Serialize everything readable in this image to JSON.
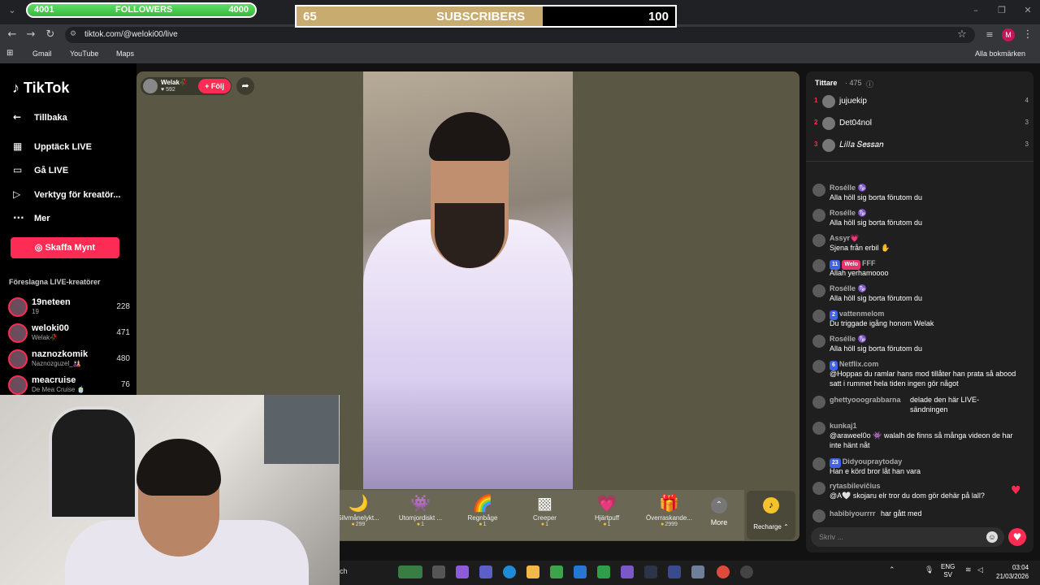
{
  "browser": {
    "url": "tiktok.com/@weloki00/live",
    "bookmarks": [
      "Gmail",
      "YouTube",
      "Maps"
    ],
    "all_bookmarks": "Alla bokmärken",
    "profile_initial": "M"
  },
  "overlays": {
    "followers": {
      "current": "4001",
      "label": "FOLLOWERS",
      "goal": "4000",
      "progress": 1.0
    },
    "subscribers": {
      "current": "65",
      "label": "SUBSCRIBERS",
      "goal": "100",
      "progress": 0.65
    }
  },
  "sidebar": {
    "logo": "TikTok",
    "back": "Tillbaka",
    "nav": [
      "Upptäck LIVE",
      "Gå LIVE",
      "Verktyg för kreatör...",
      "Mer"
    ],
    "coins_button": "Skaffa Mynt",
    "suggested_title": "Föreslagna LIVE-kreatörer",
    "creators": [
      {
        "name": "19neteen",
        "sub": "19",
        "count": "228"
      },
      {
        "name": "weloki00",
        "sub": "Welak🥀",
        "count": "471"
      },
      {
        "name": "naznozkomik",
        "sub": "Naznozguzel_🎎",
        "count": "480"
      },
      {
        "name": "meacruise",
        "sub": "De Mea Cruise 🍵",
        "count": "76"
      }
    ]
  },
  "stream": {
    "host_name": "Welak🥀",
    "host_likes": "♥ 592",
    "follow": "+ Följ"
  },
  "gifts": [
    {
      "name": "Silvmånelykt...",
      "price": "299",
      "icon": "🌙"
    },
    {
      "name": "Utomjordiskt ...",
      "price": "1",
      "icon": "👾"
    },
    {
      "name": "Regnbåge",
      "price": "1",
      "icon": "🌈"
    },
    {
      "name": "Creeper",
      "price": "1",
      "icon": "▩"
    },
    {
      "name": "Hjärtpuff",
      "price": "1",
      "icon": "💗"
    },
    {
      "name": "Överraskande...",
      "price": "2999",
      "icon": "🎁"
    }
  ],
  "more_label": "More",
  "recharge_label": "Recharge ⌃",
  "viewers": {
    "title": "Tittare",
    "count": "· 475",
    "top": [
      {
        "rank": "1",
        "name": "jujuekip",
        "score": "4"
      },
      {
        "rank": "2",
        "name": "Det04nol",
        "score": "3"
      },
      {
        "rank": "3",
        "name": "𝐿𝑖𝑙𝑙𝑎 𝑆𝑒𝑠𝑠𝑎𝑛",
        "score": "3"
      }
    ]
  },
  "chat": [
    {
      "user": "Rosélle ♑",
      "text": "Alla höll sig borta förutom du"
    },
    {
      "user": "Rosélle ♑",
      "text": "Alla höll sig borta förutom du"
    },
    {
      "user": "Assyr💗",
      "text": "Sjena från erbil ✋"
    },
    {
      "user": "FFF",
      "badges": [
        "11",
        "Welo"
      ],
      "text": "Allah yerhamoooo"
    },
    {
      "user": "Rosélle ♑",
      "text": "Alla höll sig borta förutom du"
    },
    {
      "user": "vattenmelom",
      "badges": [
        "2"
      ],
      "text": "Du triggade igång honom Welak"
    },
    {
      "user": "Rosélle ♑",
      "text": "Alla höll sig borta förutom du"
    },
    {
      "user": "Netflix.com",
      "badges": [
        "6"
      ],
      "text": "@Hoppas du ramlar hans mod tillåter han prata så abood satt i rummet hela tiden ingen gör något"
    },
    {
      "user": "ghettyooograbbarna",
      "text": "delade den här LIVE-sändningen"
    },
    {
      "user": "kunkaj1",
      "text": "@araweel0o 👾 walalh de finns så många videon de har inte hänt nåt"
    },
    {
      "user": "Didyoupraytoday",
      "badges": [
        "23"
      ],
      "text": "Han e körd bror låt han vara"
    },
    {
      "user": "rytasbilevičius",
      "text": "@A🤍 skojaru elr tror du dom gör dehär på lall?"
    },
    {
      "user": "habibiyourrrr",
      "text": "har gått med"
    }
  ],
  "chat_placeholder": "Skriv ...",
  "taskbar": {
    "search_fragment": "ch",
    "lang": "ENG",
    "lang_sub": "SV",
    "time": "03:04",
    "date": "21/03/2026"
  },
  "colors": {
    "accent": "#fe2c55",
    "followers_green": "#4bd152",
    "subs_gold": "#c8ab6e"
  }
}
